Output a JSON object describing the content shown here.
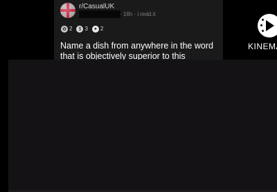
{
  "post": {
    "subreddit": "r/CasualUK",
    "meta": "· 16h · i.redd.it",
    "awards": [
      {
        "icon": "wholesome-award-icon",
        "count": "2",
        "color": "#c9c9cc",
        "glyph": "✿"
      },
      {
        "icon": "silver-award-icon",
        "count": "3",
        "color": "#d7dadc",
        "glyph": "$"
      },
      {
        "icon": "helpful-award-icon",
        "count": "2",
        "color": "#e9e9ea",
        "glyph": "✦"
      }
    ],
    "title": "Name a dish from anywhere in the word that is objectively superior to this"
  },
  "watermark": {
    "text": "KINEMA"
  }
}
